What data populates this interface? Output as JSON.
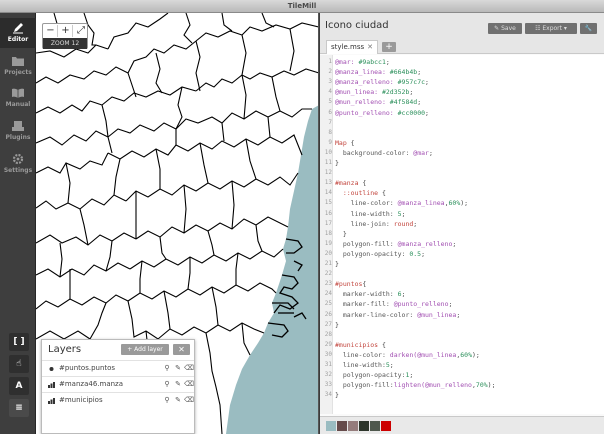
{
  "app": {
    "title": "TileMill"
  },
  "sidebar": {
    "items": [
      {
        "label": "Editor",
        "icon": "pencil-icon",
        "active": true
      },
      {
        "label": "Projects",
        "icon": "folder-icon",
        "active": false
      },
      {
        "label": "Manual",
        "icon": "book-icon",
        "active": false
      },
      {
        "label": "Plugins",
        "icon": "plug-icon",
        "active": false
      },
      {
        "label": "Settings",
        "icon": "gear-icon",
        "active": false
      }
    ],
    "tools": [
      {
        "name": "fullscreen",
        "glyph": "[ ]",
        "icon": "brackets-icon"
      },
      {
        "name": "pointer",
        "glyph": "☝",
        "icon": "hand-pointer-icon"
      },
      {
        "name": "font",
        "glyph": "A",
        "icon": "font-icon"
      },
      {
        "name": "layers",
        "glyph": "≡",
        "icon": "layers-icon"
      }
    ]
  },
  "map": {
    "zoom_out": "−",
    "zoom_in": "+",
    "fullscreen": "⤢",
    "zoom_label": "ZOOM 12",
    "land_color": "#ffffff",
    "sea_color": "#9abcc1",
    "line_color": "#000000"
  },
  "layers_panel": {
    "title": "Layers",
    "add_label": "+ Add layer",
    "close_label": "✕",
    "items": [
      {
        "name": "#puntos.puntos",
        "icon": "point-icon"
      },
      {
        "name": "#manza46.manza",
        "icon": "polygon-icon"
      },
      {
        "name": "#municipios",
        "icon": "polygon-icon"
      }
    ]
  },
  "editor": {
    "project_title": "Icono ciudad",
    "save_label": "Save",
    "export_label": "Export",
    "tab": "style.mss",
    "lines": [
      [
        [
          "@mar: ",
          "var"
        ],
        [
          "#9abcc1",
          "num"
        ],
        [
          ";",
          "pl"
        ]
      ],
      [
        [
          "@manza_linea: ",
          "var"
        ],
        [
          "#664b4b",
          "num"
        ],
        [
          ";",
          "pl"
        ]
      ],
      [
        [
          "@manza_relleno: ",
          "var"
        ],
        [
          "#957c7c",
          "num"
        ],
        [
          ";",
          "pl"
        ]
      ],
      [
        [
          "@mun_linea: ",
          "var"
        ],
        [
          "#2d352b",
          "num"
        ],
        [
          ";",
          "pl"
        ]
      ],
      [
        [
          "@mun_relleno: ",
          "var"
        ],
        [
          "#4f584d",
          "num"
        ],
        [
          ";",
          "pl"
        ]
      ],
      [
        [
          "@punto_relleno: ",
          "var"
        ],
        [
          "#cc0000",
          "num"
        ],
        [
          ";",
          "pl"
        ]
      ],
      [],
      [],
      [
        [
          "Map ",
          "sel"
        ],
        [
          "{",
          "pl"
        ]
      ],
      [
        [
          "  background-color: ",
          "prop"
        ],
        [
          "@mar",
          "var"
        ],
        [
          ";",
          "pl"
        ]
      ],
      [
        [
          "}",
          "pl"
        ]
      ],
      [],
      [
        [
          "#manza ",
          "sel"
        ],
        [
          "{",
          "pl"
        ]
      ],
      [
        [
          "  ::outline ",
          "sel"
        ],
        [
          "{",
          "pl"
        ]
      ],
      [
        [
          "    line-color: ",
          "prop"
        ],
        [
          "@manza_linea",
          "var"
        ],
        [
          ",",
          "pl"
        ],
        [
          "60%",
          "num"
        ],
        [
          ");",
          "pl"
        ]
      ],
      [
        [
          "    line-width: ",
          "prop"
        ],
        [
          "5",
          "num"
        ],
        [
          ";",
          "pl"
        ]
      ],
      [
        [
          "    line-join: ",
          "prop"
        ],
        [
          "round",
          "str"
        ],
        [
          ";",
          "pl"
        ]
      ],
      [
        [
          "  }",
          "pl"
        ]
      ],
      [
        [
          "  polygon-fill: ",
          "prop"
        ],
        [
          "@manza_relleno",
          "var"
        ],
        [
          ";",
          "pl"
        ]
      ],
      [
        [
          "  polygon-opacity: ",
          "prop"
        ],
        [
          "0.5",
          "num"
        ],
        [
          ";",
          "pl"
        ]
      ],
      [
        [
          "}",
          "pl"
        ]
      ],
      [],
      [
        [
          "#puntos",
          "sel"
        ],
        [
          "{",
          "pl"
        ]
      ],
      [
        [
          "  marker-width: ",
          "prop"
        ],
        [
          "6",
          "num"
        ],
        [
          ";",
          "pl"
        ]
      ],
      [
        [
          "  marker-fill: ",
          "prop"
        ],
        [
          "@punto_relleno",
          "var"
        ],
        [
          ";",
          "pl"
        ]
      ],
      [
        [
          "  marker-line-color: ",
          "prop"
        ],
        [
          "@mun_linea",
          "var"
        ],
        [
          ";",
          "pl"
        ]
      ],
      [
        [
          "}",
          "pl"
        ]
      ],
      [],
      [
        [
          "#municipios ",
          "sel"
        ],
        [
          "{",
          "pl"
        ]
      ],
      [
        [
          "  line-color: ",
          "prop"
        ],
        [
          "darken(",
          "kw"
        ],
        [
          "@mun_linea",
          "var"
        ],
        [
          ",",
          "pl"
        ],
        [
          "60%",
          "num"
        ],
        [
          ");",
          "pl"
        ]
      ],
      [
        [
          "  line-width:",
          "prop"
        ],
        [
          "5",
          "num"
        ],
        [
          ";",
          "pl"
        ]
      ],
      [
        [
          "  polygon-opacity:",
          "prop"
        ],
        [
          "1",
          "num"
        ],
        [
          ";",
          "pl"
        ]
      ],
      [
        [
          "  polygon-fill:",
          "prop"
        ],
        [
          "lighten(",
          "kw"
        ],
        [
          "@mun_relleno",
          "var"
        ],
        [
          ",",
          "pl"
        ],
        [
          "70%",
          "num"
        ],
        [
          ");",
          "pl"
        ]
      ],
      [
        [
          "}",
          "pl"
        ]
      ]
    ],
    "palette": [
      "#9abcc1",
      "#664b4b",
      "#957c7c",
      "#2d352b",
      "#4f584d",
      "#cc0000"
    ]
  }
}
